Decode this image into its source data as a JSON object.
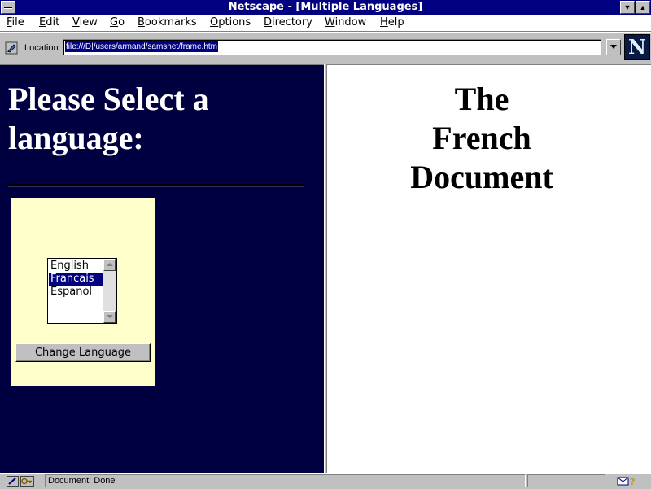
{
  "window": {
    "title": "Netscape - [Multiple Languages]",
    "minimize_glyph": "▼",
    "maximize_glyph": "▲"
  },
  "menubar": {
    "items": [
      "File",
      "Edit",
      "View",
      "Go",
      "Bookmarks",
      "Options",
      "Directory",
      "Window",
      "Help"
    ]
  },
  "location": {
    "label": "Location:",
    "url": "file:///D|/users/armand/samsnet/frame.htm"
  },
  "logo": {
    "letter": "N"
  },
  "left_frame": {
    "heading": "Please Select a language:",
    "languages": [
      "English",
      "Francais",
      "Espanol"
    ],
    "selected": "Francais",
    "button_label": "Change Language"
  },
  "right_frame": {
    "heading_lines": [
      "The",
      "French",
      "Document"
    ]
  },
  "statusbar": {
    "message": "Document: Done"
  },
  "colors": {
    "left_frame_bg": "#000040",
    "form_bg": "#ffffcc",
    "titlebar_bg": "#000080"
  },
  "icons": {
    "bookmark": "bookmark-icon",
    "security": "security-key-icon",
    "mail": "mail-icon"
  }
}
